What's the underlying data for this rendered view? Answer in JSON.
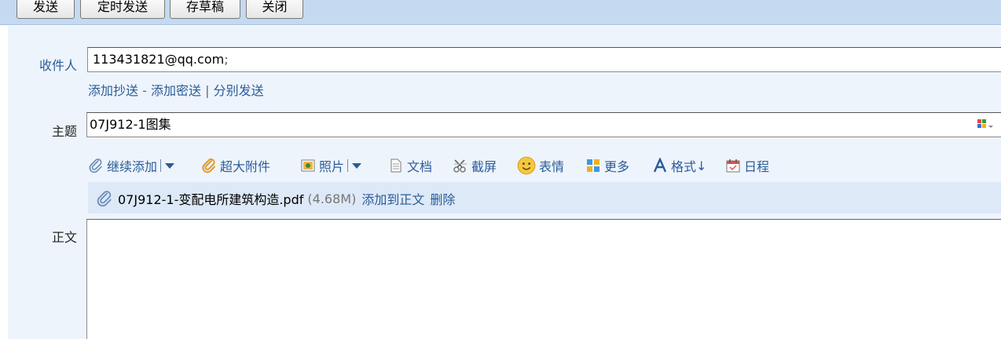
{
  "toolbar": {
    "send": "发送",
    "timed_send": "定时发送",
    "save_draft": "存草稿",
    "close": "关闭"
  },
  "recipient": {
    "label": "收件人",
    "value": "113431821@qq.com",
    "separator": ";"
  },
  "recipient_links": {
    "add_cc": "添加抄送",
    "dash": "-",
    "add_bcc": "添加密送",
    "pipe": "|",
    "send_separately": "分别发送"
  },
  "subject": {
    "label": "主题",
    "value": "07J912-1图集"
  },
  "tools": {
    "continue_add": "继续添加",
    "large_attachment": "超大附件",
    "photo": "照片",
    "document": "文档",
    "screenshot": "截屏",
    "emoji": "表情",
    "more": "更多",
    "format": "格式",
    "format_arrow": "↓",
    "schedule": "日程"
  },
  "attachment": {
    "filename": "07J912-1-变配电所建筑构造.pdf",
    "size": "(4.68M)",
    "add_to_body": "添加到正文",
    "delete": "删除"
  },
  "body": {
    "label": "正文"
  },
  "colors": {
    "toolbar_bg": "#c5d9f1",
    "panel_bg": "#eef4fb",
    "link": "#2a5c9a",
    "attach_bg": "#dde9f7"
  }
}
